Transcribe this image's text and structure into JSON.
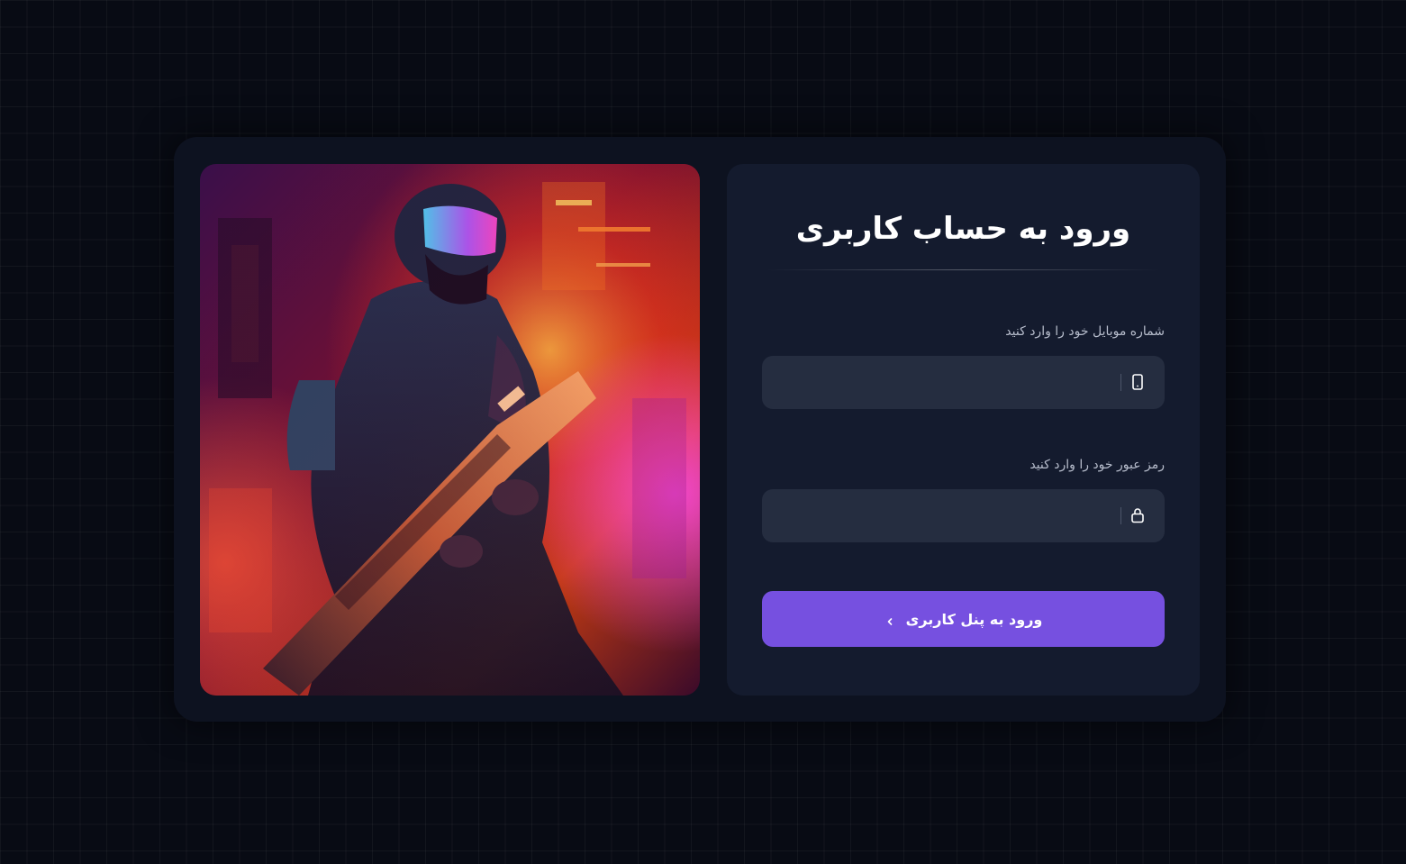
{
  "login": {
    "title": "ورود به حساب کاربری",
    "mobile": {
      "label": "شماره موبایل خود را وارد کنید",
      "value": "",
      "icon": "mobile-phone-icon"
    },
    "password": {
      "label": "رمز عبور خود را وارد کنید",
      "value": "",
      "icon": "lock-icon"
    },
    "submit": {
      "label": "ورود به پنل کاربری",
      "icon": "chevron-left-icon"
    }
  },
  "colors": {
    "page_background": "#080b14",
    "card_background": "#0d1220",
    "panel_background": "#141b2e",
    "input_background": "#252d40",
    "accent": "#7650e0"
  },
  "hero_image": {
    "subject": "cyberpunk-soldier-artwork"
  }
}
